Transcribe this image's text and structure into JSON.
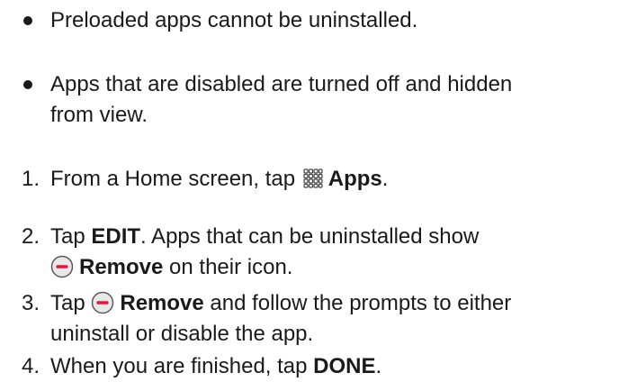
{
  "bullets": [
    {
      "text": "Preloaded apps cannot be uninstalled."
    },
    {
      "line1": "Apps that are disabled are turned off and hidden",
      "line2": "from view."
    }
  ],
  "steps": [
    {
      "num": "1.",
      "pre": "From a Home screen, tap ",
      "bold": "Apps",
      "post": ".",
      "icon": "apps-grid-icon"
    },
    {
      "num": "2.",
      "pre": "Tap ",
      "bold": "EDIT",
      "post": ". Apps that can be uninstalled show",
      "line2_bold": "Remove",
      "line2_post": " on their icon.",
      "icon": "remove-icon"
    },
    {
      "num": "3.",
      "pre": "Tap ",
      "bold": "Remove",
      "post": " and follow the prompts to either",
      "line2": "uninstall or disable the app.",
      "icon": "remove-icon"
    },
    {
      "num": "4.",
      "pre": "When you are finished, tap ",
      "bold": "DONE",
      "post": "."
    }
  ],
  "colors": {
    "text": "#1a1a1a",
    "remove_icon_border": "#5a5a5a",
    "remove_icon_fill": "#e8e8e8",
    "remove_icon_bar": "#e8143c"
  }
}
